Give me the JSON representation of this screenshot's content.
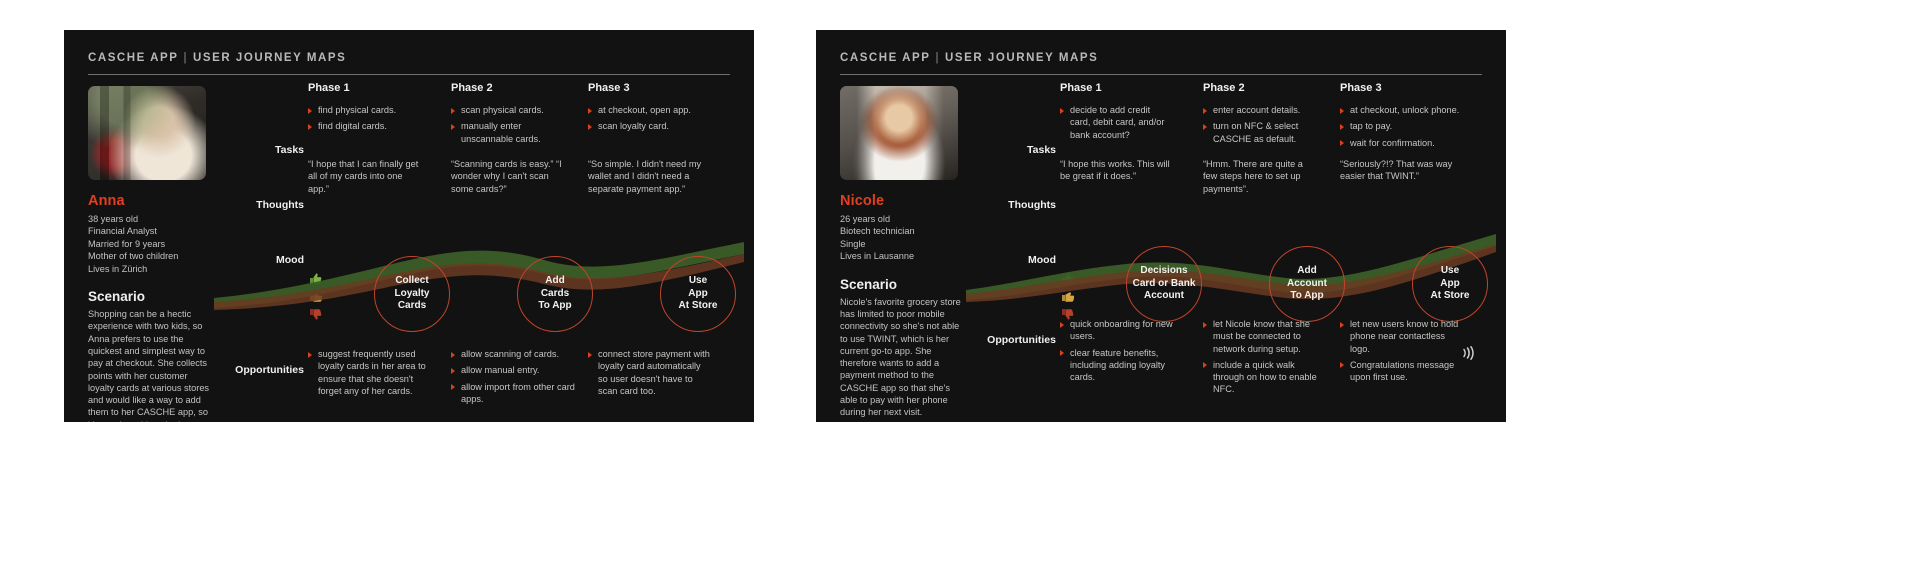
{
  "colors": {
    "panel_bg": "#121212",
    "accent_red": "#e0401f",
    "bullet_red": "#d9401d",
    "text_primary": "#f0f0ee",
    "text_secondary": "#c3c3c1",
    "circle_stroke": "#c0452a",
    "band_green": "#3c5e28",
    "band_brown": "#6b3b22"
  },
  "header": {
    "app": "CASCHE APP",
    "separator": "|",
    "section": "USER JOURNEY MAPS"
  },
  "row_labels": {
    "tasks": "Tasks",
    "thoughts": "Thoughts",
    "mood": "Mood",
    "opportunities": "Opportunities"
  },
  "phase_labels": [
    "Phase 1",
    "Phase 2",
    "Phase 3"
  ],
  "mood_icons": [
    "thumbs-up-icon",
    "thumbs-side-icon",
    "thumbs-down-icon"
  ],
  "panels": [
    {
      "id": "anna",
      "persona": {
        "photo": "anna-photo",
        "name": "Anna",
        "meta": [
          "38 years old",
          "Financial Analyst",
          "Married for 9 years",
          "Mother of two children",
          "Lives in Zürich"
        ],
        "scenario_heading": "Scenario",
        "scenario": "Shopping can be a hectic experience with two kids, so Anna prefers to use the quickest and simplest way to pay at checkout. She collects points with her customer loyalty cards at various stores and would like a way to add them to her CASCHE app, so it's one less thing she has to do in the checkout line."
      },
      "phases": [
        {
          "label": "Phase 1",
          "tasks": [
            "find physical cards.",
            "find digital cards."
          ],
          "thoughts": "“I hope that I can finally get all of my cards into one app.”",
          "stage_title": "Collect\nLoyalty\nCards",
          "opportunities": [
            "suggest frequently used loyalty cards in her area to ensure that she doesn't forget any of her cards."
          ]
        },
        {
          "label": "Phase 2",
          "tasks": [
            "scan physical cards.",
            "manually enter unscannable cards."
          ],
          "thoughts": "“Scanning cards is easy.” “I wonder why I can't scan some cards?”",
          "stage_title": "Add\nCards\nTo App",
          "opportunities": [
            "allow scanning of cards.",
            "allow manual entry.",
            "allow import from other card apps."
          ]
        },
        {
          "label": "Phase 3",
          "tasks": [
            "at checkout, open app.",
            "scan loyalty card."
          ],
          "thoughts": "“So simple. I didn't need my wallet and I didn't need a separate payment app.”",
          "stage_title": "Use\nApp\nAt Store",
          "opportunities": [
            "connect store payment with loyalty card automatically so user doesn't have to scan card too."
          ]
        }
      ]
    },
    {
      "id": "nicole",
      "persona": {
        "photo": "nicole-photo",
        "name": "Nicole",
        "meta": [
          "26 years old",
          "Biotech technician",
          "Single",
          "Lives in Lausanne"
        ],
        "scenario_heading": "Scenario",
        "scenario": "Nicole's  favorite grocery store has limited to poor mobile connectivity so she's not able to use TWINT, which is her current go-to app. She therefore wants to add a payment method to the CASCHE app so that she's able to pay with her phone during her next visit."
      },
      "phases": [
        {
          "label": "Phase 1",
          "tasks": [
            "decide to add credit card, debit card, and/or bank account?"
          ],
          "thoughts": "“I hope this works. This will be great if it does.”",
          "stage_title": "Decisions\nCard or Bank\nAccount",
          "opportunities": [
            "quick onboarding for new users.",
            "clear feature benefits, including adding loyalty cards."
          ]
        },
        {
          "label": "Phase 2",
          "tasks": [
            "enter account details.",
            "turn on NFC & select CASCHE as default."
          ],
          "thoughts": "“Hmm. There are quite a few steps here to set up payments”.",
          "stage_title": "Add\nAccount\nTo App",
          "opportunities": [
            "let Nicole know that she must be connected to network during setup.",
            "include a quick walk through on how to enable NFC."
          ]
        },
        {
          "label": "Phase 3",
          "tasks": [
            "at checkout, unlock phone.",
            "tap to pay.",
            "wait for confirmation."
          ],
          "thoughts": "“Seriously?!? That was way easier that TWINT.”",
          "stage_title": "Use\nApp\nAt Store",
          "opportunities": [
            "let new users know to hold phone near contactless logo.",
            "Congratulations message upon first use."
          ],
          "has_contactless_icon": true
        }
      ]
    }
  ]
}
